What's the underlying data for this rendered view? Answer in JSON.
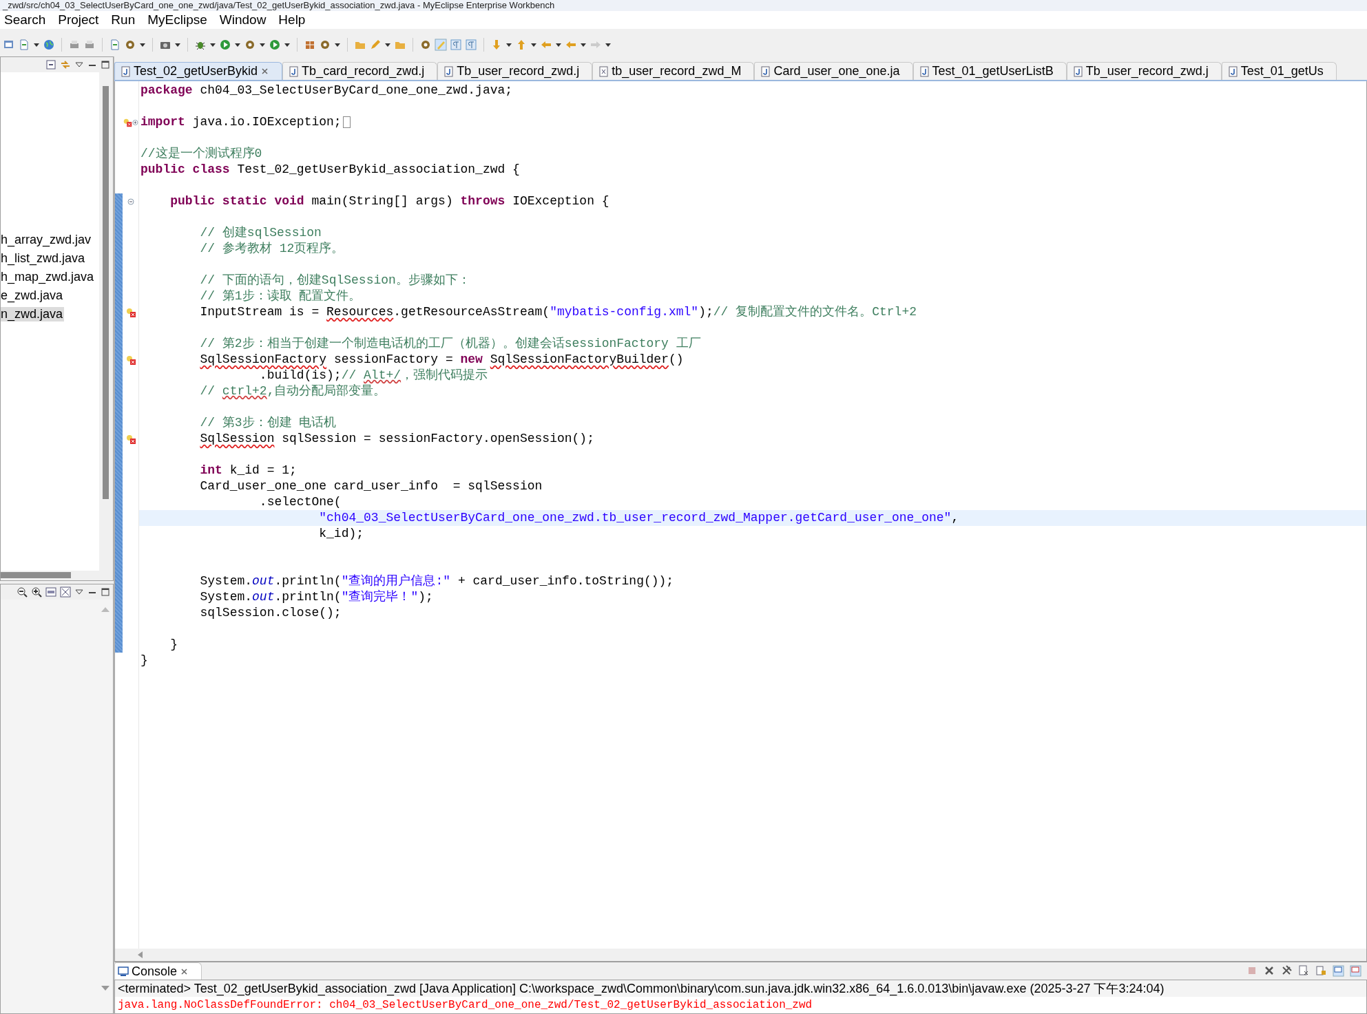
{
  "window": {
    "title": "_zwd/src/ch04_03_SelectUserByCard_one_one_zwd/java/Test_02_getUserBykid_association_zwd.java - MyEclipse Enterprise Workbench"
  },
  "menu": [
    "Search",
    "Project",
    "Run",
    "MyEclipse",
    "Window",
    "Help"
  ],
  "explorer": {
    "items": [
      {
        "label": "h_array_zwd.jav",
        "selected": false
      },
      {
        "label": "h_list_zwd.java",
        "selected": false
      },
      {
        "label": "h_map_zwd.java",
        "selected": false
      },
      {
        "label": "e_zwd.java",
        "selected": false
      },
      {
        "label": "n_zwd.java",
        "selected": true
      }
    ]
  },
  "editor_tabs": [
    {
      "label": "Test_02_getUserBykid",
      "kind": "java",
      "selected": true
    },
    {
      "label": "Tb_card_record_zwd.j",
      "kind": "java",
      "selected": false
    },
    {
      "label": "Tb_user_record_zwd.j",
      "kind": "java",
      "selected": false
    },
    {
      "label": "tb_user_record_zwd_M",
      "kind": "xml",
      "selected": false
    },
    {
      "label": "Card_user_one_one.ja",
      "kind": "java",
      "selected": false
    },
    {
      "label": "Test_01_getUserListB",
      "kind": "java",
      "selected": false
    },
    {
      "label": "Tb_user_record_zwd.j",
      "kind": "java",
      "selected": false
    },
    {
      "label": "Test_01_getUs",
      "kind": "java",
      "selected": false
    }
  ],
  "editor": {
    "lines": [
      {
        "kind": "code",
        "error": false,
        "current": false,
        "tokens": [
          {
            "kind": "kw",
            "text": "package"
          },
          {
            "kind": "plain",
            "text": " ch04_03_SelectUserByCard_one_one_zwd.java;"
          }
        ]
      },
      {
        "kind": "blank"
      },
      {
        "kind": "code",
        "error": true,
        "current": false,
        "expanded": false,
        "tokens": [
          {
            "kind": "kw",
            "text": "import"
          },
          {
            "kind": "plain",
            "text": " java.io.IOException;"
          }
        ]
      },
      {
        "kind": "blank"
      },
      {
        "kind": "code",
        "error": false,
        "current": false,
        "tokens": [
          {
            "kind": "cmt",
            "text": "//这是一个测试程序0"
          }
        ]
      },
      {
        "kind": "code",
        "error": false,
        "current": false,
        "tokens": [
          {
            "kind": "kw",
            "text": "public class"
          },
          {
            "kind": "plain",
            "text": " Test_02_getUserBykid_association_zwd {"
          }
        ]
      },
      {
        "kind": "blank"
      },
      {
        "kind": "code",
        "error": false,
        "current": false,
        "expanded": true,
        "tokens": [
          {
            "kind": "kw",
            "text": "    public static void"
          },
          {
            "kind": "plain",
            "text": " main(String[] args) "
          },
          {
            "kind": "kw",
            "text": "throws"
          },
          {
            "kind": "plain",
            "text": " IOException {"
          }
        ]
      },
      {
        "kind": "blank"
      },
      {
        "kind": "code",
        "error": false,
        "current": false,
        "tokens": [
          {
            "kind": "cmt",
            "text": "        // 创建sqlSession"
          }
        ]
      },
      {
        "kind": "code",
        "error": false,
        "current": false,
        "tokens": [
          {
            "kind": "cmt",
            "text": "        // 参考教材 12页程序。"
          }
        ]
      },
      {
        "kind": "blank"
      },
      {
        "kind": "code",
        "error": false,
        "current": false,
        "tokens": [
          {
            "kind": "cmt",
            "text": "        // 下面的语句，创建SqlSession。步骤如下："
          }
        ]
      },
      {
        "kind": "code",
        "error": false,
        "current": false,
        "tokens": [
          {
            "kind": "cmt",
            "text": "        // 第1步：读取 配置文件。"
          }
        ]
      },
      {
        "kind": "code",
        "error": true,
        "current": false,
        "tokens": [
          {
            "kind": "plain",
            "text": "        InputStream is = "
          },
          {
            "kind": "err",
            "text": "Resources"
          },
          {
            "kind": "plain",
            "text": ".getResourceAsStream("
          },
          {
            "kind": "str",
            "text": "\"mybatis-config.xml\""
          },
          {
            "kind": "plain",
            "text": ");"
          },
          {
            "kind": "cmt",
            "text": "// 复制配置文件的文件名。Ctrl+2"
          }
        ]
      },
      {
        "kind": "blank"
      },
      {
        "kind": "code",
        "error": false,
        "current": false,
        "tokens": [
          {
            "kind": "cmt",
            "text": "        // 第2步：相当于创建一个制造电话机的工厂（机器）。创建会话sessionFactory 工厂"
          }
        ]
      },
      {
        "kind": "code",
        "error": true,
        "current": false,
        "tokens": [
          {
            "kind": "err",
            "text": "        SqlSessionFactory"
          },
          {
            "kind": "plain",
            "text": " sessionFactory = "
          },
          {
            "kind": "kw",
            "text": "new "
          },
          {
            "kind": "err",
            "text": "SqlSessionFactoryBuilder"
          },
          {
            "kind": "plain",
            "text": "()"
          }
        ]
      },
      {
        "kind": "code",
        "error": false,
        "current": false,
        "tokens": [
          {
            "kind": "plain",
            "text": "                .build(is);"
          },
          {
            "kind": "cmt",
            "text": "// "
          },
          {
            "kind": "cmt_err",
            "text": "Alt+/"
          },
          {
            "kind": "cmt",
            "text": "，强制代码提示"
          }
        ]
      },
      {
        "kind": "code",
        "error": false,
        "current": false,
        "tokens": [
          {
            "kind": "cmt",
            "text": "        // "
          },
          {
            "kind": "cmt_err",
            "text": "ctrl+2"
          },
          {
            "kind": "cmt",
            "text": ",自动分配局部变量。"
          }
        ]
      },
      {
        "kind": "blank"
      },
      {
        "kind": "code",
        "error": false,
        "current": false,
        "tokens": [
          {
            "kind": "cmt",
            "text": "        // 第3步：创建 电话机"
          }
        ]
      },
      {
        "kind": "code",
        "error": true,
        "current": false,
        "tokens": [
          {
            "kind": "err",
            "text": "        SqlSession"
          },
          {
            "kind": "plain",
            "text": " sqlSession = sessionFactory.openSession();"
          }
        ]
      },
      {
        "kind": "blank"
      },
      {
        "kind": "code",
        "error": false,
        "current": false,
        "tokens": [
          {
            "kind": "kw",
            "text": "        int"
          },
          {
            "kind": "plain",
            "text": " k_id = 1;"
          }
        ]
      },
      {
        "kind": "code",
        "error": false,
        "current": false,
        "tokens": [
          {
            "kind": "plain",
            "text": "        Card_user_one_one card_user_info  = sqlSession"
          }
        ]
      },
      {
        "kind": "code",
        "error": false,
        "current": false,
        "tokens": [
          {
            "kind": "plain",
            "text": "                .selectOne("
          }
        ]
      },
      {
        "kind": "code",
        "error": false,
        "current": true,
        "tokens": [
          {
            "kind": "str",
            "text": "                        \"ch04_03_SelectUserByCard_one_one_zwd.tb_user_record_zwd_Mapper.getCard_user_one_one\""
          },
          {
            "kind": "plain",
            "text": ","
          }
        ]
      },
      {
        "kind": "code",
        "error": false,
        "current": false,
        "tokens": [
          {
            "kind": "plain",
            "text": "                        k_id);"
          }
        ]
      },
      {
        "kind": "blank"
      },
      {
        "kind": "blank"
      },
      {
        "kind": "code",
        "error": false,
        "current": false,
        "tokens": [
          {
            "kind": "plain",
            "text": "        System."
          },
          {
            "kind": "field",
            "text": "out"
          },
          {
            "kind": "plain",
            "text": ".println("
          },
          {
            "kind": "str",
            "text": "\"查询的用户信息:\""
          },
          {
            "kind": "plain",
            "text": " + card_user_info.toString());"
          }
        ]
      },
      {
        "kind": "code",
        "error": false,
        "current": false,
        "tokens": [
          {
            "kind": "plain",
            "text": "        System."
          },
          {
            "kind": "field",
            "text": "out"
          },
          {
            "kind": "plain",
            "text": ".println("
          },
          {
            "kind": "str",
            "text": "\"查询完毕！\""
          },
          {
            "kind": "plain",
            "text": ");"
          }
        ]
      },
      {
        "kind": "code",
        "error": false,
        "current": false,
        "tokens": [
          {
            "kind": "plain",
            "text": "        sqlSession.close();"
          }
        ]
      },
      {
        "kind": "blank"
      },
      {
        "kind": "code",
        "error": false,
        "current": false,
        "tokens": [
          {
            "kind": "plain",
            "text": "    }"
          }
        ]
      },
      {
        "kind": "code",
        "error": false,
        "current": false,
        "tokens": [
          {
            "kind": "plain",
            "text": "}"
          }
        ]
      }
    ]
  },
  "console": {
    "tab": "Console",
    "header": "<terminated> Test_02_getUserBykid_association_zwd [Java Application] C:\\workspace_zwd\\Common\\binary\\com.sun.java.jdk.win32.x86_64_1.6.0.013\\bin\\javaw.exe (2025-3-27 下午3:24:04)",
    "error": "java.lang.NoClassDefFoundError: ch04_03_SelectUserByCard_one_one_zwd/Test_02_getUserBykid_association_zwd"
  }
}
